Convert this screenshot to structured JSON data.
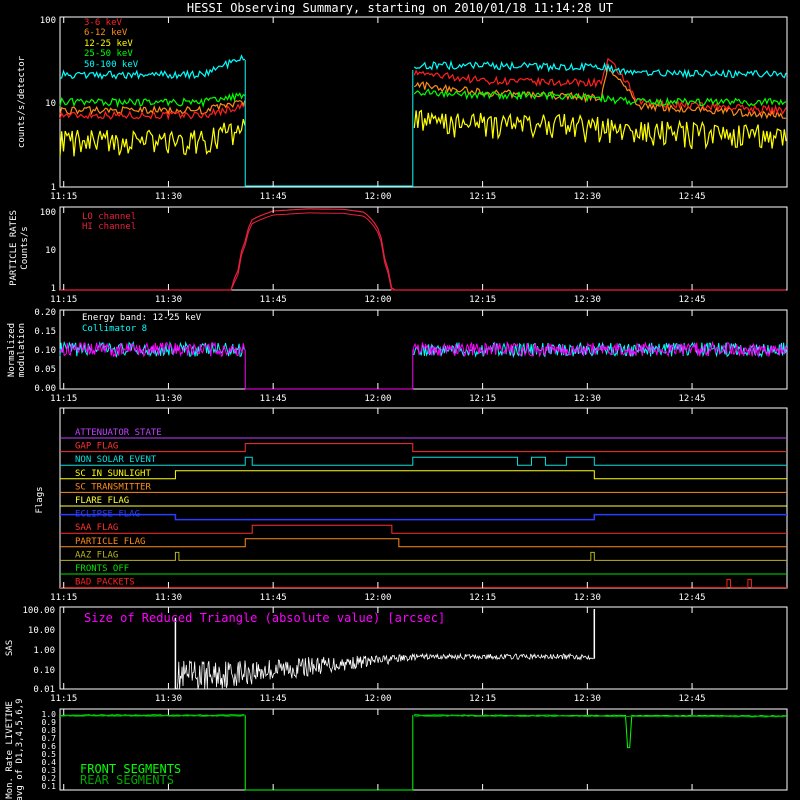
{
  "title": "HESSI Observing Summary, starting on 2010/01/18 11:14:28 UT",
  "time_labels": [
    "11:15",
    "11:30",
    "11:45",
    "12:00",
    "12:15",
    "12:30",
    "12:45"
  ],
  "colors": {
    "b3_6": "#ff2020",
    "b6_12": "#ff8c1a",
    "b12_25": "#ffff00",
    "b25_50": "#00ff00",
    "b50_100": "#00ffff",
    "particle": "#e8213c",
    "modulation": "#ff00ff",
    "collimator": "#00ffff",
    "sas": "#ffffff",
    "livetime_front": "#00ff00",
    "livetime_rear": "#00a800",
    "sas_label": "#ff00ff",
    "axes": "#ffffff"
  },
  "panels": {
    "counts": {
      "ylabel": "counts/s/detector",
      "yticks": [
        "100",
        "10",
        "1"
      ],
      "legend": [
        {
          "label": "3-6 keV",
          "color": "#ff2020"
        },
        {
          "label": "6-12 keV",
          "color": "#ff8c1a"
        },
        {
          "label": "12-25 keV",
          "color": "#ffff00"
        },
        {
          "label": "25-50 keV",
          "color": "#00ff00"
        },
        {
          "label": "50-100 keV",
          "color": "#00ffff"
        }
      ]
    },
    "particle": {
      "ylabel_1": "PARTICLE RATES",
      "ylabel_2": "Counts/s",
      "yticks": [
        "100",
        "10",
        "1"
      ],
      "legend": [
        {
          "label": "LO channel",
          "color": "#e8213c"
        },
        {
          "label": "HI channel",
          "color": "#e8213c"
        }
      ]
    },
    "modulation": {
      "ylabel_1": "Normalized",
      "ylabel_2": "modulation",
      "yticks": [
        "0.20",
        "0.15",
        "0.10",
        "0.05",
        "0.00"
      ],
      "legend": [
        {
          "label": "Energy band: 12-25 keV",
          "color": "#ffffff"
        },
        {
          "label": "Collimator 8",
          "color": "#00ffff"
        }
      ]
    },
    "flags": {
      "ylabel": "Flags",
      "items": [
        {
          "label": "ATTENUATOR STATE",
          "color": "#c040ff"
        },
        {
          "label": "GAP FLAG",
          "color": "#ff3030"
        },
        {
          "label": "NON SOLAR EVENT",
          "color": "#00e0e0"
        },
        {
          "label": "SC IN SUNLIGHT",
          "color": "#ffff00"
        },
        {
          "label": "SC TRANSMITTER",
          "color": "#ff8c1a"
        },
        {
          "label": "FLARE FLAG",
          "color": "#ffff40"
        },
        {
          "label": "ECLIPSE FLAG",
          "color": "#2a3cff"
        },
        {
          "label": "SAA FLAG",
          "color": "#ff3030"
        },
        {
          "label": "PARTICLE FLAG",
          "color": "#ff8c1a"
        },
        {
          "label": "AAZ FLAG",
          "color": "#b5b520"
        },
        {
          "label": "FRONTS OFF",
          "color": "#00e000"
        },
        {
          "label": "BAD PACKETS",
          "color": "#ff2020"
        }
      ]
    },
    "sas": {
      "ylabel": "SAS",
      "yticks": [
        "100.00",
        "10.00",
        "1.00",
        "0.10",
        "0.01"
      ],
      "annotation": "Size of Reduced Triangle (absolute value) [arcsec]"
    },
    "livetime": {
      "ylabel_1": "Mon. Rate LIVETIME",
      "ylabel_2": "avg of D1,3,4,5,6,9",
      "yticks": [
        "1.0",
        "0.9",
        "0.8",
        "0.7",
        "0.6",
        "0.5",
        "0.4",
        "0.3",
        "0.2",
        "0.1"
      ],
      "legend": [
        {
          "label": "FRONT SEGMENTS",
          "color": "#00ff00"
        },
        {
          "label": "REAR SEGMENTS",
          "color": "#00a800"
        }
      ]
    }
  },
  "chart_data": [
    {
      "type": "line",
      "title": "HESSI Observing Summary, starting on 2010/01/18 11:14:28 UT",
      "ylabel": "counts/s/detector",
      "yscale": "log",
      "ylim": [
        1,
        100
      ],
      "x_ticks": [
        "11:15",
        "11:30",
        "11:45",
        "12:00",
        "12:15",
        "12:30",
        "12:45"
      ],
      "series": [
        {
          "name": "3-6 keV",
          "x": [
            "11:15",
            "11:35",
            "11:41",
            "12:05",
            "12:15",
            "12:25",
            "12:32",
            "12:33",
            "12:37",
            "12:58"
          ],
          "values": [
            7,
            7,
            9,
            22,
            18,
            17,
            17,
            30,
            10,
            8
          ]
        },
        {
          "name": "6-12 keV",
          "x": [
            "11:15",
            "11:35",
            "11:41",
            "12:05",
            "12:15",
            "12:25",
            "12:32",
            "12:33",
            "12:37",
            "12:58"
          ],
          "values": [
            8,
            8,
            10,
            16,
            13,
            12,
            11,
            25,
            9,
            7
          ]
        },
        {
          "name": "12-25 keV",
          "x": [
            "11:15",
            "11:35",
            "11:41",
            "12:05",
            "12:15",
            "12:25",
            "12:32",
            "12:37",
            "12:58"
          ],
          "values": [
            3.5,
            3.5,
            5,
            6,
            5.5,
            5.5,
            5,
            4.5,
            4
          ]
        },
        {
          "name": "25-50 keV",
          "x": [
            "11:15",
            "11:35",
            "11:41",
            "12:05",
            "12:15",
            "12:25",
            "12:32",
            "12:37",
            "12:58"
          ],
          "values": [
            10,
            10,
            12,
            13,
            12,
            12,
            11,
            10,
            10
          ]
        },
        {
          "name": "50-100 keV",
          "x": [
            "11:15",
            "11:35",
            "11:41",
            "12:05",
            "12:15",
            "12:25",
            "12:32",
            "12:37",
            "12:58"
          ],
          "values": [
            21,
            21,
            33,
            27,
            27,
            26,
            26,
            22,
            21
          ]
        }
      ]
    },
    {
      "type": "line",
      "ylabel": "PARTICLE RATES Counts/s",
      "yscale": "log",
      "ylim": [
        1,
        100
      ],
      "series": [
        {
          "name": "LO channel",
          "x": [
            "11:15",
            "11:39",
            "11:40",
            "11:41",
            "11:42",
            "11:45",
            "11:50",
            "11:55",
            "11:58",
            "12:00",
            "12:01",
            "12:02",
            "12:58"
          ],
          "values": [
            1,
            1,
            3,
            15,
            50,
            80,
            90,
            88,
            75,
            30,
            5,
            1,
            1
          ]
        }
      ]
    },
    {
      "type": "line",
      "ylabel": "Normalized modulation",
      "ylim": [
        0,
        0.2
      ],
      "series": [
        {
          "name": "Collimator 8",
          "x": [
            "11:15",
            "11:41",
            "12:05",
            "12:58"
          ],
          "values": [
            0.1,
            0.1,
            0.1,
            0.1
          ]
        }
      ]
    },
    {
      "type": "line",
      "ylabel": "SAS",
      "yscale": "log",
      "ylim": [
        0.01,
        100
      ],
      "series": [
        {
          "name": "Size of Reduced Triangle (absolute value) [arcsec]",
          "x": [
            "11:30",
            "11:32",
            "11:45",
            "12:00",
            "12:15",
            "12:30",
            "12:31"
          ],
          "values": [
            30,
            0.05,
            0.1,
            0.4,
            0.4,
            0.4,
            80
          ]
        }
      ]
    },
    {
      "type": "line",
      "ylabel": "Mon. Rate LIVETIME avg of D1,3,4,5,6,9",
      "ylim": [
        0,
        1
      ],
      "series": [
        {
          "name": "FRONT SEGMENTS",
          "x": [
            "11:15",
            "11:41",
            "12:05",
            "12:58"
          ],
          "values": [
            0.97,
            0.97,
            0.97,
            0.96
          ]
        },
        {
          "name": "REAR SEGMENTS",
          "x": [
            "11:15",
            "11:41",
            "12:05",
            "12:58"
          ],
          "values": [
            0.96,
            0.96,
            0.96,
            0.95
          ]
        }
      ]
    }
  ]
}
